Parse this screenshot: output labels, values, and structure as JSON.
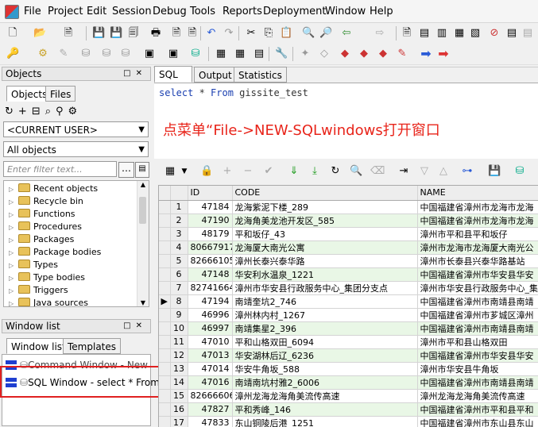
{
  "menu": [
    "File",
    "Project",
    "Edit",
    "Session",
    "Debug",
    "Tools",
    "Reports",
    "Deployment",
    "Window",
    "Help"
  ],
  "objects_panel": {
    "title": "Objects",
    "tabs": [
      "Objects",
      "Files"
    ],
    "user_combo": "<CURRENT USER>",
    "filter_combo": "All objects",
    "filter_placeholder": "Enter filter text...",
    "tree": [
      "Recent objects",
      "Recycle bin",
      "Functions",
      "Procedures",
      "Packages",
      "Package bodies",
      "Types",
      "Type bodies",
      "Triggers",
      "Java sources"
    ]
  },
  "window_list": {
    "title": "Window list",
    "tabs": [
      "Window list",
      "Templates"
    ],
    "items": [
      "Command Window - New",
      "SQL Window - select * From g"
    ]
  },
  "editor": {
    "tabs": [
      "SQL",
      "Output",
      "Statistics"
    ],
    "sql_keyword1": "select",
    "sql_rest1": " * ",
    "sql_keyword2": "From",
    "sql_rest2": " gissite_test",
    "annotation": "点菜单“File->NEW-SQLwindows打开窗口"
  },
  "grid": {
    "columns": [
      "",
      "",
      "ID",
      "CODE",
      "NAME"
    ],
    "current_row": 8,
    "rows": [
      [
        "1",
        "47184",
        "龙海紫泥下楼_289",
        "中国福建省漳州市龙海市龙海"
      ],
      [
        "2",
        "47190",
        "龙海角美龙池开发区_585",
        "中国福建省漳州市龙海市龙海"
      ],
      [
        "3",
        "48179",
        "平和坂仔_43",
        "漳州市平和县平和坂仔"
      ],
      [
        "4",
        "80667917",
        "龙海厦大南光公寓",
        "漳州市龙海市龙海厦大南光公"
      ],
      [
        "5",
        "82666105",
        "漳州长泰兴泰华路",
        "漳州市长泰县兴泰华路基站"
      ],
      [
        "6",
        "47148",
        "华安利水温泉_1221",
        "中国福建省漳州市华安县华安"
      ],
      [
        "7",
        "82741664",
        "漳州市华安县行政服务中心_集团分支点",
        "漳州市华安县行政服务中心_集"
      ],
      [
        "8",
        "47194",
        "南靖奎坑2_746",
        "中国福建省漳州市南靖县南靖"
      ],
      [
        "9",
        "46996",
        "漳州林内村_1267",
        "中国福建省漳州市芗城区漳州"
      ],
      [
        "10",
        "46997",
        "南靖集星2_396",
        "中国福建省漳州市南靖县南靖"
      ],
      [
        "11",
        "47010",
        "平和山格双田_6094",
        "漳州市平和县山格双田"
      ],
      [
        "12",
        "47013",
        "华安湖林后辽_6236",
        "中国福建省漳州市华安县华安"
      ],
      [
        "13",
        "47014",
        "华安牛角坂_588",
        "漳州市华安县牛角坂"
      ],
      [
        "14",
        "47016",
        "南靖南坑村雅2_6006",
        "中国福建省漳州市南靖县南靖"
      ],
      [
        "15",
        "82666606",
        "漳州龙海龙海角美流传高速",
        "漳州龙海龙海角美流传高速"
      ],
      [
        "16",
        "47827",
        "平和秀峰_146",
        "中国福建省漳州市平和县平和"
      ],
      [
        "17",
        "47833",
        "东山铜陵后港_1251",
        "中国福建省漳州市东山县东山"
      ]
    ]
  }
}
